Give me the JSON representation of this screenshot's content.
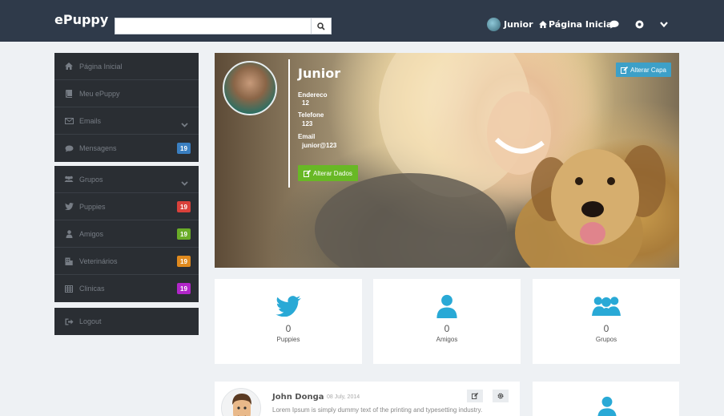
{
  "header": {
    "brand": "ePuppy",
    "search": {
      "value": "",
      "placeholder": ""
    },
    "user_name": "Junior",
    "home_label": "Página Inicial"
  },
  "sidebar": {
    "main_items": [
      {
        "label": "Página Inicial",
        "icon": "home-icon"
      },
      {
        "label": "Meu ePuppy",
        "icon": "book-icon"
      },
      {
        "label": "Emails",
        "icon": "envelope-icon"
      },
      {
        "label": "Mensagens",
        "icon": "comment-icon",
        "badge": "19",
        "badge_color": "#3a7fc1"
      }
    ],
    "group_items": [
      {
        "label": "Grupos",
        "icon": "group-icon"
      },
      {
        "label": "Puppies",
        "icon": "twitter-icon",
        "badge": "19",
        "badge_color": "#d9413b"
      },
      {
        "label": "Amigos",
        "icon": "user-icon",
        "badge": "19",
        "badge_color": "#6aac28"
      },
      {
        "label": "Veterinários",
        "icon": "building-icon",
        "badge": "19",
        "badge_color": "#e08a1e"
      },
      {
        "label": "Clinicas",
        "icon": "table-icon",
        "badge": "19",
        "badge_color": "#b126c9"
      }
    ],
    "logout_label": "Logout"
  },
  "profile": {
    "name": "Junior",
    "address_label": "Endereco",
    "address_value": "12",
    "phone_label": "Telefone",
    "phone_value": "123",
    "email_label": "Email",
    "email_value": "junior@123",
    "edit_data_label": "Alterar Dados",
    "edit_cover_label": "Alterar Capa"
  },
  "stats": [
    {
      "value": "0",
      "label": "Puppies",
      "icon": "twitter-icon"
    },
    {
      "value": "0",
      "label": "Amigos",
      "icon": "user-icon"
    },
    {
      "value": "0",
      "label": "Grupos",
      "icon": "group-icon"
    }
  ],
  "post": {
    "author": "John Donga",
    "date": "08 July, 2014",
    "text": "Lorem Ipsum is simply dummy text of the printing and typesetting industry."
  },
  "colors": {
    "topbar": "#2f3a4a",
    "accent": "#29a9d6",
    "green": "#68b825",
    "blue": "#3da0c8"
  }
}
